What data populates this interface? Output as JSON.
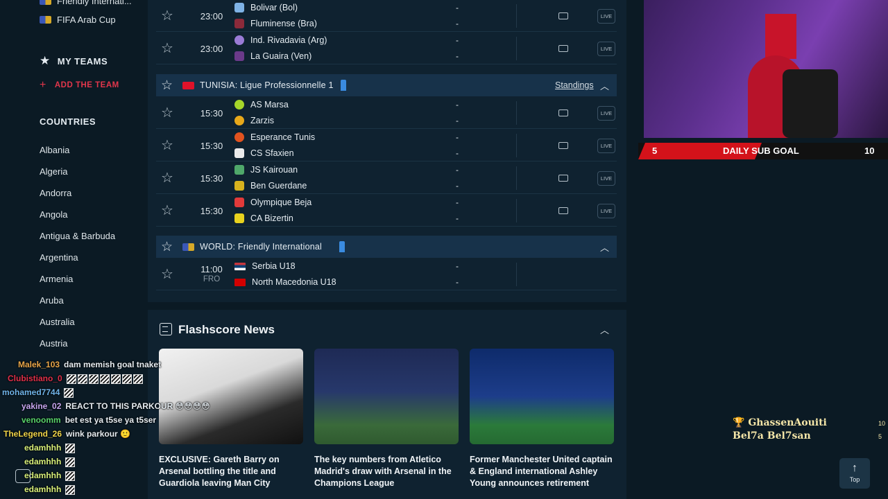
{
  "sidebar": {
    "top_leagues": [
      {
        "label": "Friendly Internati..."
      },
      {
        "label": "FIFA Arab Cup"
      }
    ],
    "my_teams_label": "MY TEAMS",
    "add_team_label": "ADD THE TEAM",
    "countries_label": "COUNTRIES",
    "countries": [
      "Albania",
      "Algeria",
      "Andorra",
      "Angola",
      "Antigua & Barbuda",
      "Argentina",
      "Armenia",
      "Aruba",
      "Australia",
      "Austria"
    ]
  },
  "matches_top": [
    {
      "time": "23:00",
      "home": "Bolivar (Bol)",
      "away": "Fluminense (Bra)",
      "score_home": "-",
      "score_away": "-",
      "live": "LIVE"
    },
    {
      "time": "23:00",
      "home": "Ind. Rivadavia (Arg)",
      "away": "La Guaira (Ven)",
      "score_home": "-",
      "score_away": "-",
      "live": "LIVE"
    }
  ],
  "league_tunisia": {
    "name": "TUNISIA: Ligue Professionnelle 1",
    "standings": "Standings",
    "matches": [
      {
        "time": "15:30",
        "home": "AS Marsa",
        "away": "Zarzis",
        "score_home": "-",
        "score_away": "-",
        "live": "LIVE"
      },
      {
        "time": "15:30",
        "home": "Esperance Tunis",
        "away": "CS Sfaxien",
        "score_home": "-",
        "score_away": "-",
        "live": "LIVE"
      },
      {
        "time": "15:30",
        "home": "JS Kairouan",
        "away": "Ben Guerdane",
        "score_home": "-",
        "score_away": "-",
        "live": "LIVE"
      },
      {
        "time": "15:30",
        "home": "Olympique Beja",
        "away": "CA Bizertin",
        "score_home": "-",
        "score_away": "-",
        "live": "LIVE"
      }
    ]
  },
  "league_world": {
    "name": "WORLD: Friendly International",
    "matches": [
      {
        "time": "11:00",
        "status": "FRO",
        "home": "Serbia U18",
        "away": "North Macedonia U18",
        "score_home": "-",
        "score_away": "-"
      }
    ]
  },
  "news": {
    "title": "Flashscore News",
    "cards": [
      {
        "text": "EXCLUSIVE: Gareth Barry on Arsenal bottling the title and Guardiola leaving Man City"
      },
      {
        "text": "The key numbers from Atletico Madrid's draw with Arsenal in the Champions League"
      },
      {
        "text": "Former Manchester United captain & England international Ashley Young announces retirement"
      }
    ]
  },
  "stream": {
    "goal_current": "5",
    "goal_label": "DAILY SUB GOAL",
    "goal_target": "10",
    "goal_progress": 0.5,
    "leaders": [
      {
        "name": "GhassenAouiti",
        "count": "10"
      },
      {
        "name": "Bel7a Bel7san",
        "count": "5"
      }
    ],
    "top_button": "Top"
  },
  "chat": [
    {
      "user": "Malek_103",
      "msg": "dam memish goal tnaket",
      "color": "#e8a64a"
    },
    {
      "user": "Clubistiano_0",
      "msg": "",
      "color": "#e0304a"
    },
    {
      "user": "mohamed7744",
      "msg": "",
      "color": "#6fb3e8"
    },
    {
      "user": "yakine_02",
      "msg": "REACT TO THIS PARKOUR 😳😳😳😳",
      "color": "#c7a6f0"
    },
    {
      "user": "venoomm",
      "msg": "bet est ya t5se ya t5ser",
      "color": "#58d36b"
    },
    {
      "user": "TheLegend_26",
      "msg": "wink parkour 🙂",
      "color": "#f0d54a"
    },
    {
      "user": "edamhhh",
      "msg": "",
      "color": "#d8f07a"
    },
    {
      "user": "edamhhh",
      "msg": "",
      "color": "#d8f07a"
    },
    {
      "user": "edamhhh",
      "msg": "",
      "color": "#d8f07a"
    },
    {
      "user": "edamhhh",
      "msg": "",
      "color": "#d8f07a"
    }
  ]
}
